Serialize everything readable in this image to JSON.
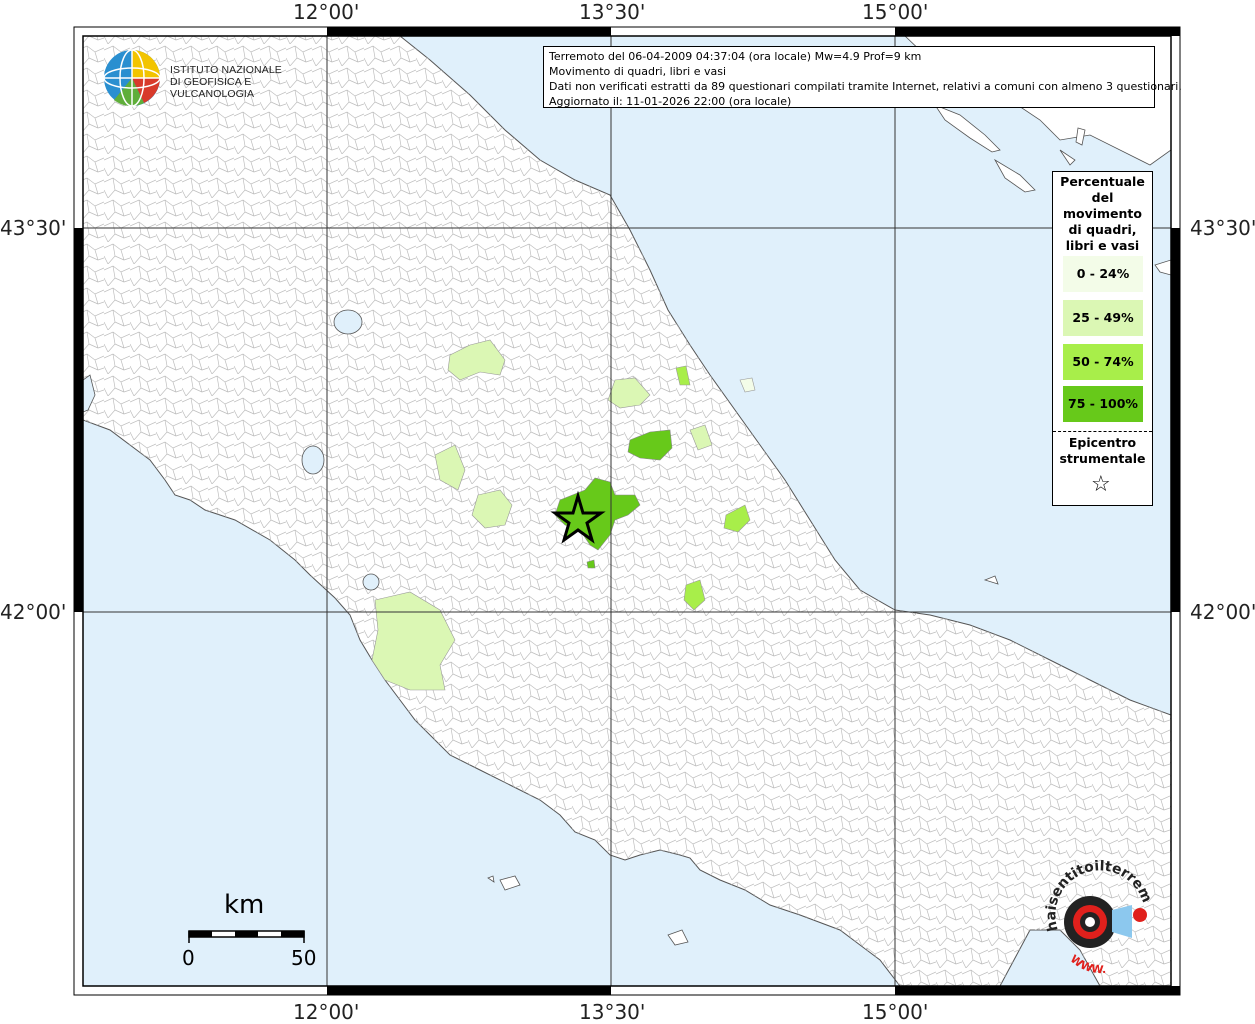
{
  "map": {
    "longitude_labels": [
      "12°00'",
      "13°30'",
      "15°00'"
    ],
    "latitude_labels": [
      "43°30'",
      "42°00'"
    ],
    "colors": {
      "sea": "#e0f0fb",
      "land": "#ffffff",
      "boundary": "#b5b5b5",
      "class_0_24": "#f3fce8",
      "class_25_49": "#dbf7b4",
      "class_50_74": "#a8ee4a",
      "class_75_100": "#67c91a",
      "frame": "#000000"
    }
  },
  "logo": {
    "line1": "ISTITUTO NAZIONALE",
    "line2": "DI GEOFISICA E VULCANOLOGIA"
  },
  "info": {
    "line1": "Terremoto del 06-04-2009 04:37:04 (ora locale) Mw=4.9 Prof=9 km",
    "line2": "Movimento di quadri, libri e vasi",
    "line3": "Dati non verificati estratti da 89 questionari compilati tramite Internet, relativi a comuni con almeno 3 questionari.",
    "line4": "Aggiornato il: 11-01-2026 22:00 (ora locale)"
  },
  "legend": {
    "title_lines": [
      "Percentuale",
      "del",
      "movimento",
      "di quadri,",
      "libri e vasi"
    ],
    "classes": [
      {
        "label": "0 - 24%",
        "color": "#f3fce8"
      },
      {
        "label": "25 - 49%",
        "color": "#dbf7b4"
      },
      {
        "label": "50 - 74%",
        "color": "#a8ee4a"
      },
      {
        "label": "75 - 100%",
        "color": "#67c91a"
      }
    ],
    "epicenter_line1": "Epicentro",
    "epicenter_line2": "strumentale",
    "epicenter_symbol": "☆"
  },
  "scale_bar": {
    "unit": "km",
    "min": "0",
    "max": "50"
  },
  "watermark": {
    "text": "haisentitoilterremoto.it",
    "url_text": "WWW."
  }
}
